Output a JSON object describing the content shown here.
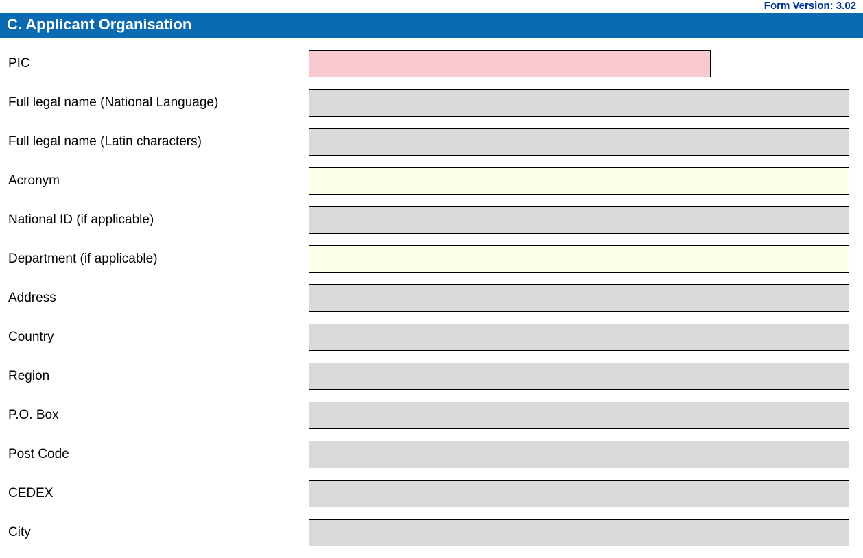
{
  "version_label": "Form Version: 3.02",
  "section_title": "C. Applicant Organisation",
  "fields": [
    {
      "label": "PIC",
      "style": "pink",
      "width": "short"
    },
    {
      "label": "Full legal name (National Language)",
      "style": "gray",
      "width": "full"
    },
    {
      "label": "Full legal name (Latin characters)",
      "style": "gray",
      "width": "full"
    },
    {
      "label": "Acronym",
      "style": "yellow",
      "width": "full"
    },
    {
      "label": "National ID (if applicable)",
      "style": "gray",
      "width": "full"
    },
    {
      "label": "Department (if applicable)",
      "style": "yellow",
      "width": "full"
    },
    {
      "label": "Address",
      "style": "gray",
      "width": "full"
    },
    {
      "label": "Country",
      "style": "gray",
      "width": "full"
    },
    {
      "label": "Region",
      "style": "gray",
      "width": "full"
    },
    {
      "label": "P.O. Box",
      "style": "gray",
      "width": "full"
    },
    {
      "label": "Post Code",
      "style": "gray",
      "width": "full"
    },
    {
      "label": "CEDEX",
      "style": "gray",
      "width": "full"
    },
    {
      "label": "City",
      "style": "gray",
      "width": "full"
    }
  ]
}
